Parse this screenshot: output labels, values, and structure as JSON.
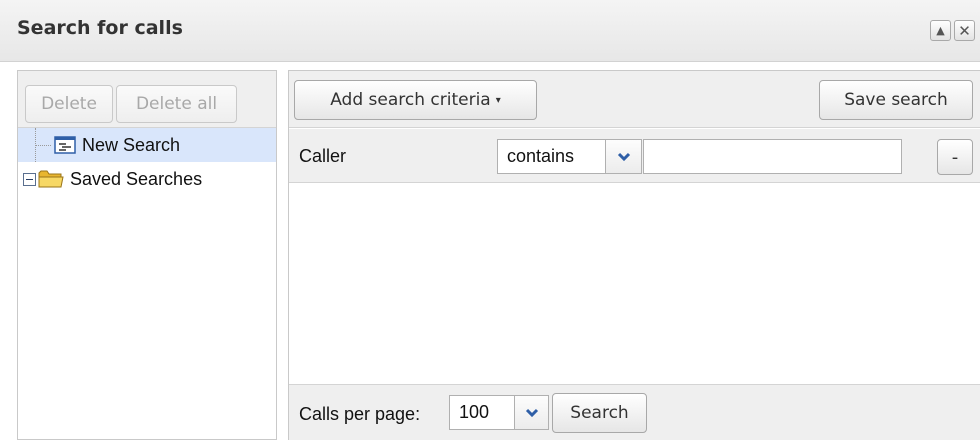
{
  "window": {
    "title": "Search for calls",
    "collapse_icon": "triangle-up-icon",
    "close_icon": "close-icon"
  },
  "left_toolbar": {
    "delete_label": "Delete",
    "delete_all_label": "Delete all"
  },
  "tree": {
    "items": [
      {
        "label": "New Search",
        "icon": "search-document-icon",
        "selected": true
      },
      {
        "label": "Saved Searches",
        "icon": "folder-icon",
        "expanded": true
      }
    ]
  },
  "right_toolbar": {
    "add_criteria_label": "Add search criteria",
    "add_criteria_arrow": "▾",
    "save_search_label": "Save search"
  },
  "criteria": [
    {
      "field_label": "Caller",
      "operator": "contains",
      "value": "",
      "remove_label": "-"
    }
  ],
  "footer": {
    "calls_per_page_label": "Calls per page:",
    "calls_per_page_value": "100",
    "search_label": "Search"
  },
  "colors": {
    "accent_blue": "#2f5fa7",
    "selection_bg": "#d9e6fb",
    "folder_yellow": "#f2c744"
  }
}
